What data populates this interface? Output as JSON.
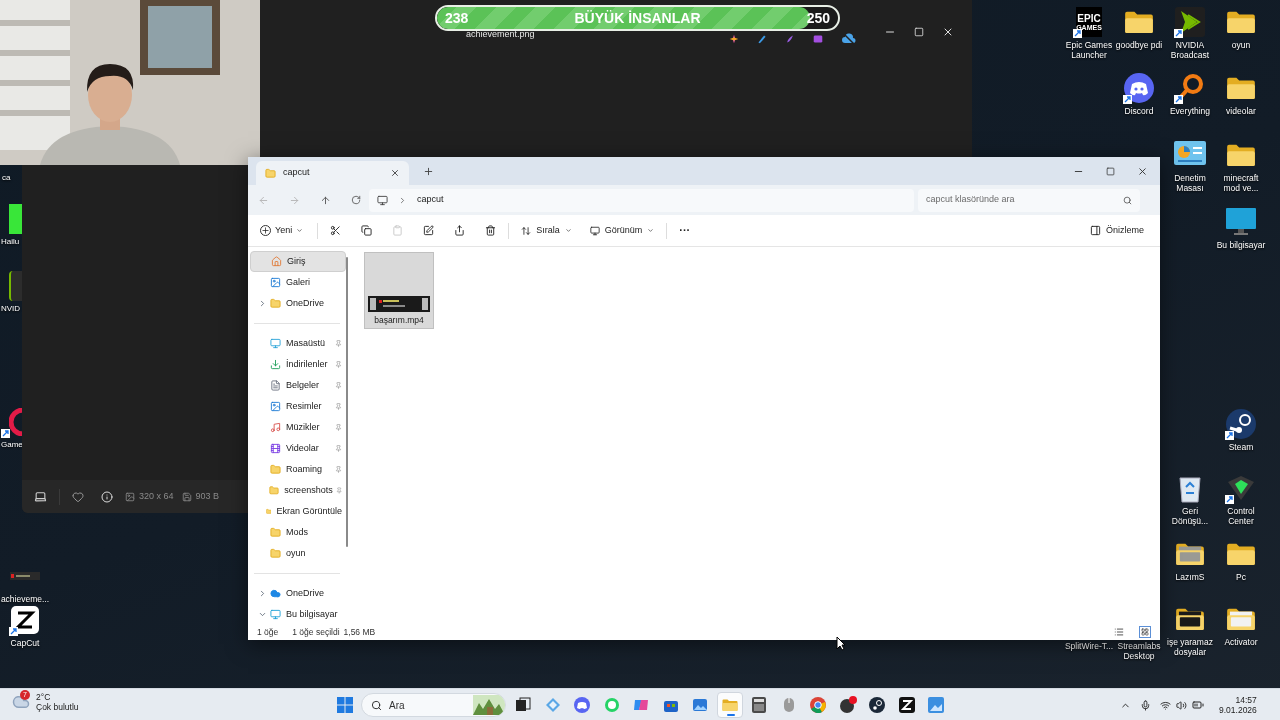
{
  "achievement": {
    "start": "238",
    "title": "BÜYÜK İNSANLAR",
    "end": "250",
    "level": 0.93
  },
  "image_viewer": {
    "title": "achievement.png",
    "dimensions": "320 x 64",
    "file_size": "903 B",
    "favorite": false
  },
  "explorer": {
    "tab": "capcut",
    "address": "capcut",
    "search": {
      "placeholder": "capcut klasöründe ara"
    },
    "toolbar": {
      "new": "Yeni",
      "sort": "Sırala",
      "view": "Görünüm",
      "more": "···",
      "preview": "Önizleme",
      "paste_disabled": true
    },
    "sidebar": [
      {
        "items": [
          {
            "label": "Giriş",
            "pinned": false,
            "selected": true
          },
          {
            "label": "Galeri",
            "pinned": false,
            "selected": false
          },
          {
            "label": "OneDrive",
            "pinned": false,
            "selected": false,
            "expanded": false
          }
        ]
      },
      {
        "items": [
          {
            "label": "Masaüstü",
            "pinned": true,
            "selected": false
          },
          {
            "label": "İndirilenler",
            "pinned": true,
            "selected": false
          },
          {
            "label": "Belgeler",
            "pinned": true,
            "selected": false
          },
          {
            "label": "Resimler",
            "pinned": true,
            "selected": false
          },
          {
            "label": "Müzikler",
            "pinned": true,
            "selected": false
          },
          {
            "label": "Videolar",
            "pinned": true,
            "selected": false
          },
          {
            "label": "Roaming",
            "pinned": true,
            "selected": false
          },
          {
            "label": "screenshots",
            "pinned": true,
            "selected": false
          },
          {
            "label": "Ekran Görüntüle",
            "pinned": false,
            "selected": false
          },
          {
            "label": "Mods",
            "pinned": false,
            "selected": false
          },
          {
            "label": "oyun",
            "pinned": false,
            "selected": false
          }
        ]
      },
      {
        "items": [
          {
            "label": "OneDrive",
            "pinned": false,
            "selected": false,
            "expanded": false
          },
          {
            "label": "Bu bilgisayar",
            "pinned": false,
            "selected": false,
            "expanded": true
          }
        ]
      }
    ],
    "files": [
      {
        "name": "başarım.mp4",
        "selected": true
      }
    ],
    "status_bar": {
      "count": "1 öğe",
      "selection": "1 öğe seçildi",
      "size": "1,56 MB"
    },
    "view_buttons": [
      {
        "selected": false
      },
      {
        "selected": true
      }
    ]
  },
  "desktop_left": [
    {
      "label": "ca"
    },
    {
      "label": "Hailu",
      "shortcut": false
    },
    {
      "label": "NVID",
      "shortcut": false
    },
    {
      "label": "Game",
      "shortcut": true
    },
    {
      "label": "achieveme...",
      "shortcut": false
    },
    {
      "label": "CapCut",
      "shortcut": true
    }
  ],
  "desktop_right": [
    {
      "label": "Epic Games Launcher",
      "logo": "EPIC",
      "logo_sub": "GAMES",
      "shortcut": true
    },
    {
      "label": "goodbye pdi",
      "shortcut": false
    },
    {
      "label": "NVIDIA Broadcast",
      "shortcut": true
    },
    {
      "label": "oyun",
      "shortcut": false
    },
    {
      "label": "Discord",
      "shortcut": true
    },
    {
      "label": "Everything",
      "shortcut": true
    },
    {
      "label": "videolar",
      "shortcut": false
    },
    {
      "label": "Denetim Masası",
      "shortcut": false
    },
    {
      "label": "minecraft mod ve...",
      "shortcut": false
    },
    {
      "label": "Bu bilgisayar",
      "shortcut": false
    },
    {
      "label": "Steam",
      "shortcut": true
    },
    {
      "label": "Geri Dönüşü...",
      "shortcut": false
    },
    {
      "label": "Control Center",
      "shortcut": true
    },
    {
      "label": "LazımS",
      "shortcut": false
    },
    {
      "label": "Pc",
      "shortcut": false
    },
    {
      "label": "SplitWire-T..."
    },
    {
      "label": "Streamlabs Desktop"
    },
    {
      "label": "işe yaramaz dosyalar",
      "shortcut": false
    },
    {
      "label": "Activator",
      "shortcut": false
    }
  ],
  "taskbar": {
    "weather": {
      "temp": "2°C",
      "condition": "Çok bulutlu",
      "badge": "7"
    },
    "search": {
      "placeholder": "Ara"
    },
    "apps": [
      {
        "selected": false
      },
      {
        "selected": false
      },
      {
        "selected": false
      },
      {
        "selected": false
      },
      {
        "selected": false
      },
      {
        "selected": false
      },
      {
        "selected": false
      },
      {
        "selected": true
      },
      {
        "selected": false
      },
      {
        "selected": false
      },
      {
        "selected": false
      },
      {
        "selected": false
      },
      {
        "selected": false
      },
      {
        "selected": false
      },
      {
        "selected": false
      }
    ],
    "time": "14:57",
    "date": "9.01.2026"
  }
}
